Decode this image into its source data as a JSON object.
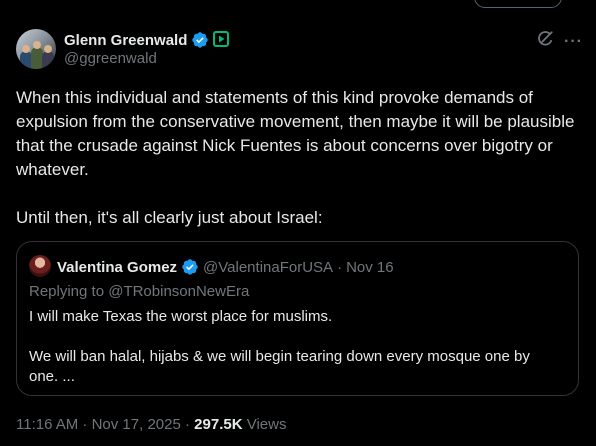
{
  "author": {
    "display_name": "Glenn Greenwald",
    "handle": "@ggreenwald",
    "verified": true,
    "affiliate_badge_color": "#00ba7c"
  },
  "header_actions": {
    "icons": [
      "grok-icon",
      "more-icon"
    ],
    "more_label": "···"
  },
  "tweet": {
    "paragraphs": [
      "When this individual and statements of this kind provoke demands of expulsion from the conservative movement, then maybe it will be plausible that the crusade against Nick Fuentes is about concerns over bigotry or whatever.",
      "Until then, it's all clearly just about Israel:"
    ]
  },
  "quote": {
    "display_name": "Valentina Gomez",
    "handle": "@ValentinaForUSA",
    "separator": "·",
    "date": "Nov 16",
    "reply_context": "Replying to @TRobinsonNewEra",
    "paragraphs": [
      "I will make Texas the worst place for muslims.",
      "We will ban halal, hijabs & we will begin tearing down every mosque one by one. ..."
    ]
  },
  "meta": {
    "time_date": "11:16 AM · Nov 17, 2025 ·",
    "views_count": "297.5K",
    "views_label": "Views"
  },
  "colors": {
    "background": "#000000",
    "primary_text": "#e7e9ea",
    "secondary_text": "#71767b",
    "border": "#2f3336",
    "verified_blue": "#1d9bf0"
  }
}
